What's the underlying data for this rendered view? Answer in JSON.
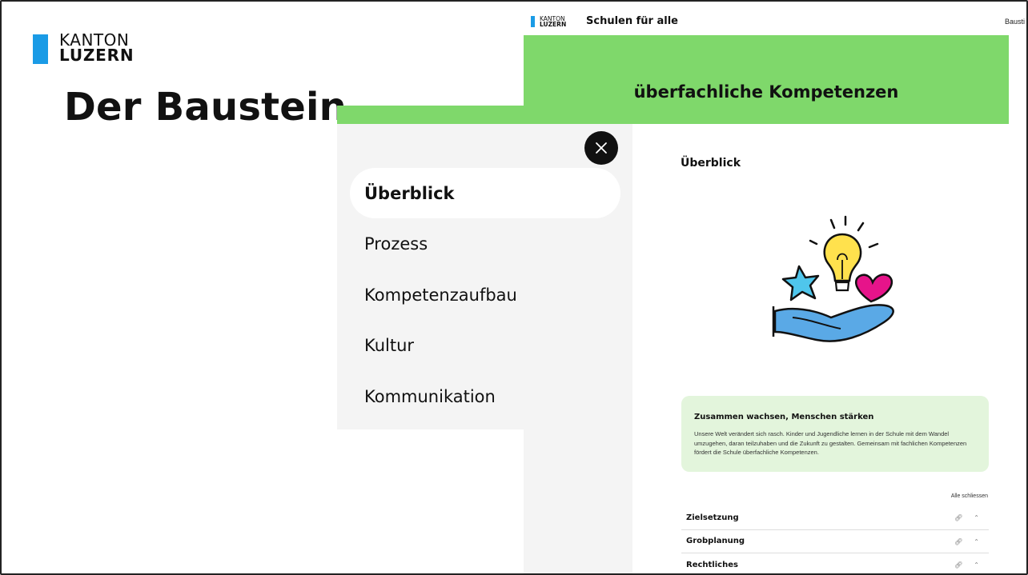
{
  "slide": {
    "logo": {
      "line1": "KANTON",
      "line2": "LUZERN"
    },
    "title": "Der Baustein"
  },
  "site": {
    "logo": {
      "line1": "KANTON",
      "line2": "LUZERN"
    },
    "title": "Schulen für alle",
    "header_link": "Bausti",
    "hero_title": "überfachliche Kompetenzen"
  },
  "nav": {
    "items": [
      {
        "label": "Überblick",
        "active": true
      },
      {
        "label": "Prozess"
      },
      {
        "label": "Kompetenzaufbau"
      },
      {
        "label": "Kultur"
      },
      {
        "label": "Kommunikation"
      }
    ]
  },
  "content": {
    "heading": "Überblick",
    "info_box": {
      "title": "Zusammen wachsen, Menschen stärken",
      "text": "Unsere Welt verändert sich rasch. Kinder und Jugendliche lernen in der Schule mit dem Wandel umzugehen, daran teilzuhaben und die Zukunft zu gestalten. Gemeinsam mit fachlichen Kompetenzen fördert die Schule überfachliche Kompetenzen."
    },
    "collapse_all": "Alle schliessen",
    "accordion": [
      {
        "label": "Zielsetzung"
      },
      {
        "label": "Grobplanung"
      },
      {
        "label": "Rechtliches"
      }
    ]
  },
  "icons": {
    "close": "close-icon",
    "link": "link-icon",
    "chevron": "chevron-up-icon",
    "illustration": "hand-with-bulb-star-heart-illustration"
  },
  "colors": {
    "brand_blue": "#1a9be6",
    "hero_green": "#7fd86b",
    "info_green": "#e3f5dc",
    "nav_bg": "#f4f4f4"
  }
}
